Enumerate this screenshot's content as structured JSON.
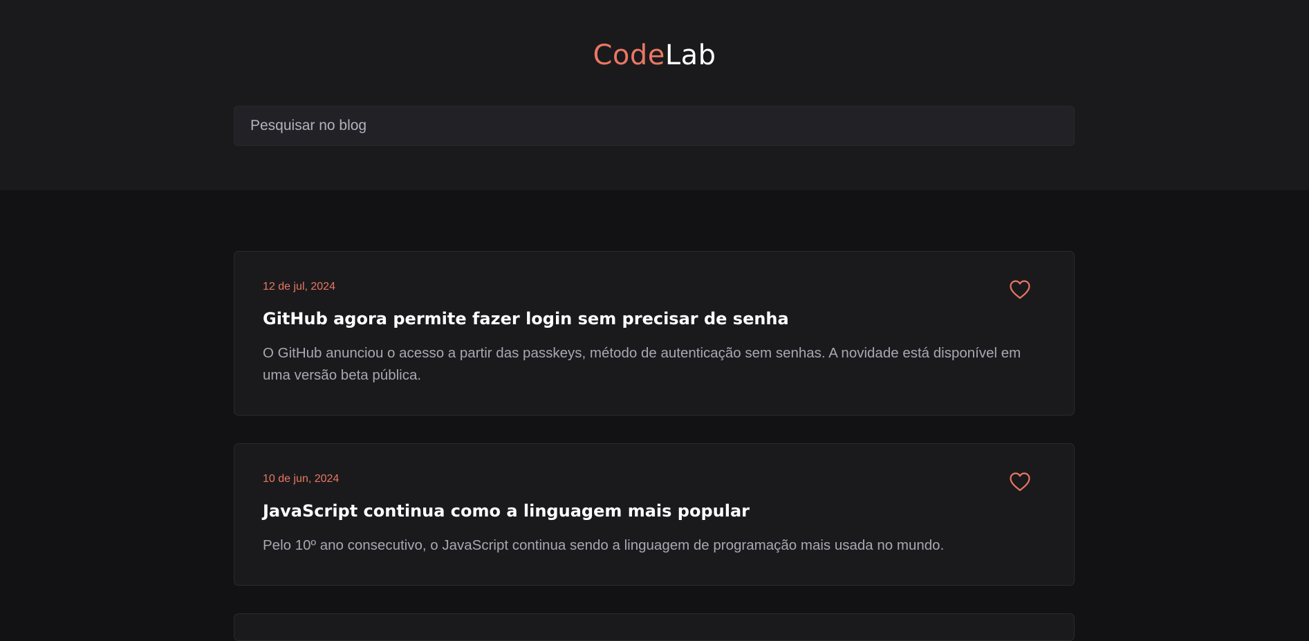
{
  "header": {
    "logo_code": "Code",
    "logo_lab": "Lab",
    "search_placeholder": "Pesquisar no blog"
  },
  "colors": {
    "accent": "#ea7762",
    "header_bg": "#1a1a1d",
    "page_bg": "#121214",
    "card_bg": "#1a1a1d"
  },
  "posts": [
    {
      "date": "12 de jul, 2024",
      "title": "GitHub agora permite fazer login sem precisar de senha",
      "excerpt": "O GitHub anunciou o acesso a partir das passkeys, método de autenticação sem senhas. A novidade está disponível em uma versão beta pública.",
      "icon": "heart-icon"
    },
    {
      "date": "10 de jun, 2024",
      "title": "JavaScript continua como a linguagem mais popular",
      "excerpt": "Pelo 10º ano consecutivo, o JavaScript continua sendo a linguagem de programação mais usada no mundo.",
      "icon": "heart-icon"
    }
  ]
}
